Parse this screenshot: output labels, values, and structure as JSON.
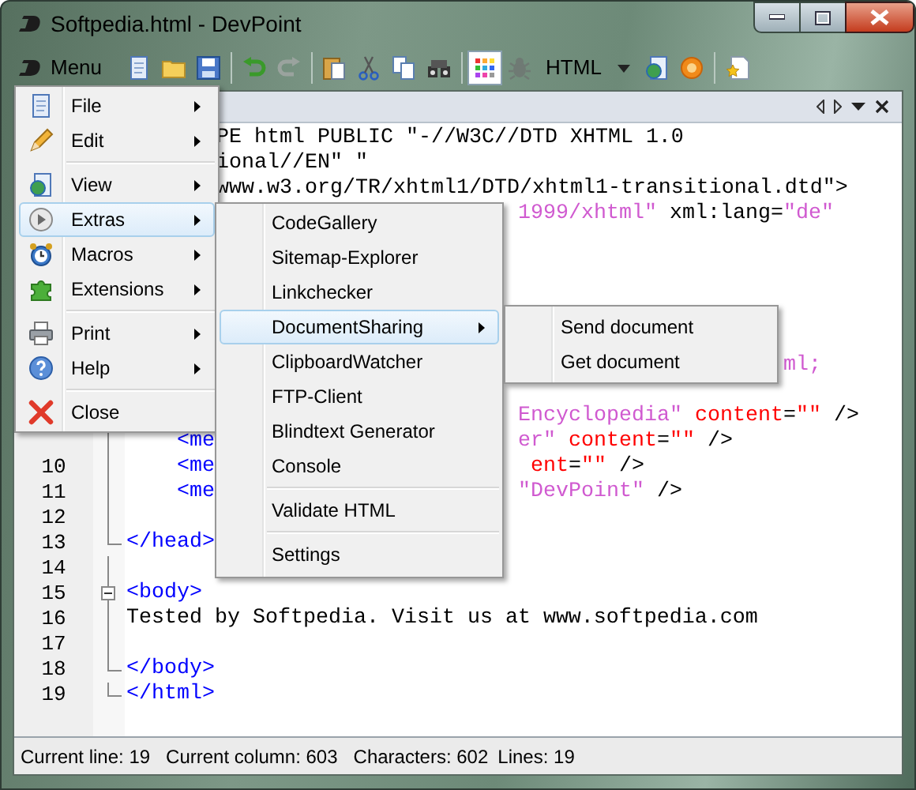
{
  "window": {
    "title": "Softpedia.html - DevPoint"
  },
  "toolbar": {
    "menu_label": "Menu",
    "language": "HTML",
    "redo_disabled": true
  },
  "main_menu": [
    {
      "kind": "item",
      "label": "File",
      "has_submenu": true,
      "selected": false
    },
    {
      "kind": "item",
      "label": "Edit",
      "has_submenu": true,
      "selected": false
    },
    {
      "kind": "separator"
    },
    {
      "kind": "item",
      "label": "View",
      "has_submenu": true,
      "selected": false
    },
    {
      "kind": "item",
      "label": "Extras",
      "has_submenu": true,
      "selected": true
    },
    {
      "kind": "item",
      "label": "Macros",
      "has_submenu": true,
      "selected": false
    },
    {
      "kind": "item",
      "label": "Extensions",
      "has_submenu": true,
      "selected": false
    },
    {
      "kind": "separator"
    },
    {
      "kind": "item",
      "label": "Print",
      "has_submenu": true,
      "selected": false
    },
    {
      "kind": "item",
      "label": "Help",
      "has_submenu": true,
      "selected": false
    },
    {
      "kind": "separator"
    },
    {
      "kind": "item",
      "label": "Close",
      "has_submenu": false,
      "selected": false
    }
  ],
  "extras_menu": [
    {
      "kind": "item",
      "label": "CodeGallery",
      "has_submenu": false,
      "selected": false
    },
    {
      "kind": "item",
      "label": "Sitemap-Explorer",
      "has_submenu": false,
      "selected": false
    },
    {
      "kind": "item",
      "label": "Linkchecker",
      "has_submenu": false,
      "selected": false
    },
    {
      "kind": "item",
      "label": "DocumentSharing",
      "has_submenu": true,
      "selected": true
    },
    {
      "kind": "item",
      "label": "ClipboardWatcher",
      "has_submenu": false,
      "selected": false
    },
    {
      "kind": "item",
      "label": "FTP-Client",
      "has_submenu": false,
      "selected": false
    },
    {
      "kind": "item",
      "label": "Blindtext Generator",
      "has_submenu": false,
      "selected": false
    },
    {
      "kind": "item",
      "label": "Console",
      "has_submenu": false,
      "selected": false
    },
    {
      "kind": "separator"
    },
    {
      "kind": "item",
      "label": "Validate HTML",
      "has_submenu": false,
      "selected": false
    },
    {
      "kind": "separator"
    },
    {
      "kind": "item",
      "label": "Settings",
      "has_submenu": false,
      "selected": false
    }
  ],
  "sharing_menu": [
    {
      "kind": "item",
      "label": "Send document",
      "has_submenu": false,
      "selected": false
    },
    {
      "kind": "item",
      "label": "Get document",
      "has_submenu": false,
      "selected": false
    }
  ],
  "editor": {
    "rows": [
      {
        "fragments": [
          [
            {
              "kind": "text",
              "text": "PE html PUBLIC \"-//W3C//DTD XHTML 1.0"
            }
          ]
        ]
      },
      {
        "fragments": [
          [
            {
              "kind": "text",
              "text": "ional//EN\" \""
            }
          ]
        ]
      },
      {
        "fragments": [
          [
            {
              "kind": "text",
              "text": "www.w3.org/TR/xhtml1/DTD/xhtml1-transitional.dtd\">"
            }
          ]
        ]
      },
      {
        "fragments": [
          [
            {
              "kind": "value",
              "text": "1999/xhtml\""
            },
            {
              "kind": "text",
              "text": " xml:lang="
            },
            {
              "kind": "value",
              "text": "\"de\""
            }
          ]
        ]
      },
      {},
      {},
      {},
      {},
      {},
      {
        "fragments": [
          [
            {
              "kind": "value",
              "text": "ml;"
            }
          ]
        ]
      },
      {},
      {
        "fragments": [
          [
            {
              "kind": "value",
              "text": "Encyclopedia\""
            },
            {
              "kind": "attr",
              "text": " content"
            },
            {
              "kind": "text",
              "text": "="
            },
            {
              "kind": "attr",
              "text": "\"\""
            },
            {
              "kind": "text",
              "text": " />"
            }
          ]
        ]
      },
      {
        "fold": {
          "kind": "line"
        },
        "fragments": [
          [
            {
              "kind": "tag",
              "text": "<me"
            }
          ],
          [
            {
              "kind": "value",
              "text": "er\""
            },
            {
              "kind": "attr",
              "text": " content"
            },
            {
              "kind": "text",
              "text": "="
            },
            {
              "kind": "attr",
              "text": "\"\""
            },
            {
              "kind": "text",
              "text": " />"
            }
          ]
        ]
      },
      {
        "number": "10",
        "fold": {
          "kind": "line"
        },
        "fragments": [
          [
            {
              "kind": "tag",
              "text": "<me"
            }
          ],
          [
            {
              "kind": "attr",
              "text": "ent"
            },
            {
              "kind": "text",
              "text": "="
            },
            {
              "kind": "attr",
              "text": "\"\""
            },
            {
              "kind": "text",
              "text": " />"
            }
          ]
        ]
      },
      {
        "number": "11",
        "fold": {
          "kind": "line"
        },
        "fragments": [
          [
            {
              "kind": "tag",
              "text": "<me"
            }
          ],
          [
            {
              "kind": "value",
              "text": "\"DevPoint\""
            },
            {
              "kind": "text",
              "text": " />"
            }
          ]
        ]
      },
      {
        "number": "12",
        "fold": {
          "kind": "line"
        }
      },
      {
        "number": "13",
        "fold": {
          "kind": "end"
        },
        "fragments": [
          [
            {
              "kind": "tag",
              "text": "</head>"
            }
          ]
        ]
      },
      {
        "number": "14",
        "fold": {
          "kind": "line"
        }
      },
      {
        "number": "15",
        "fold": {
          "kind": "start"
        },
        "fragments": [
          [
            {
              "kind": "tag",
              "text": "<body>"
            }
          ]
        ]
      },
      {
        "number": "16",
        "fold": {
          "kind": "line"
        },
        "fragments": [
          [
            {
              "kind": "text",
              "text": "Tested by Softpedia. Visit us at www.softpedia.com"
            }
          ]
        ]
      },
      {
        "number": "17",
        "fold": {
          "kind": "line"
        }
      },
      {
        "number": "18",
        "fold": {
          "kind": "end"
        },
        "fragments": [
          [
            {
              "kind": "tag",
              "text": "</body>"
            }
          ]
        ]
      },
      {
        "number": "19",
        "fold": {
          "kind": "end"
        },
        "fragments": [
          [
            {
              "kind": "tag",
              "text": "</html>"
            }
          ]
        ]
      }
    ]
  },
  "status_bar": [
    "Current line: 19",
    "Current column: 603",
    "Characters: 602",
    "Lines: 19"
  ]
}
